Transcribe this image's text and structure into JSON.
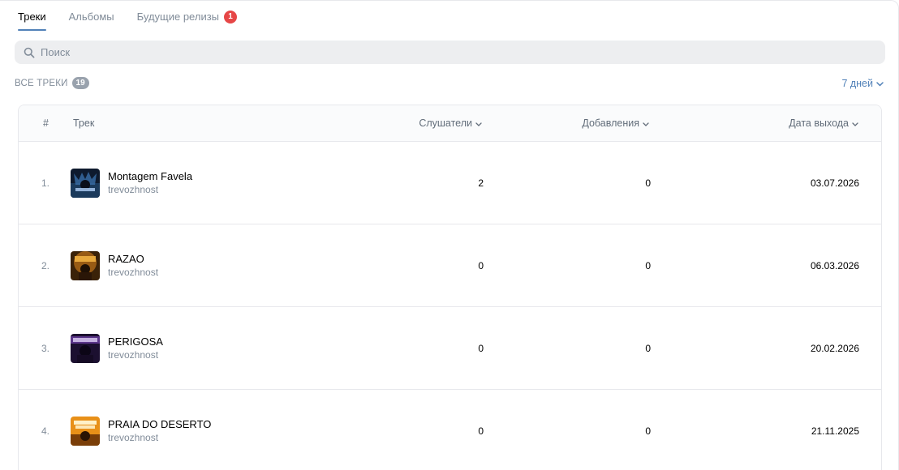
{
  "tabs": [
    {
      "label": "Треки",
      "active": true
    },
    {
      "label": "Альбомы",
      "active": false
    },
    {
      "label": "Будущие релизы",
      "active": false,
      "badge": "1"
    }
  ],
  "search": {
    "placeholder": "Поиск",
    "value": ""
  },
  "section": {
    "title": "ВСЕ ТРЕКИ",
    "count": "19"
  },
  "period": {
    "label": "7 дней"
  },
  "table": {
    "headers": {
      "num": "#",
      "track": "Трек",
      "listeners": "Слушатели",
      "adds": "Добавления",
      "date": "Дата выхода"
    },
    "rows": [
      {
        "num": "1.",
        "title": "Montagem Favela",
        "artist": "trevozhnost",
        "listeners": "2",
        "adds": "0",
        "date": "03.07.2026",
        "cover": "cover-montagem-favela"
      },
      {
        "num": "2.",
        "title": "RAZAO",
        "artist": "trevozhnost",
        "listeners": "0",
        "adds": "0",
        "date": "06.03.2026",
        "cover": "cover-razao"
      },
      {
        "num": "3.",
        "title": "PERIGOSA",
        "artist": "trevozhnost",
        "listeners": "0",
        "adds": "0",
        "date": "20.02.2026",
        "cover": "cover-perigosa"
      },
      {
        "num": "4.",
        "title": "PRAIA DO DESERTO",
        "artist": "trevozhnost",
        "listeners": "0",
        "adds": "0",
        "date": "21.11.2025",
        "cover": "cover-praia-do-deserto"
      }
    ]
  },
  "colors": {
    "accent": "#5181b8",
    "badge_red": "#e64646",
    "muted": "#818c99"
  },
  "icons": {
    "search": "search-icon",
    "chevron": "chevron-down-icon"
  }
}
